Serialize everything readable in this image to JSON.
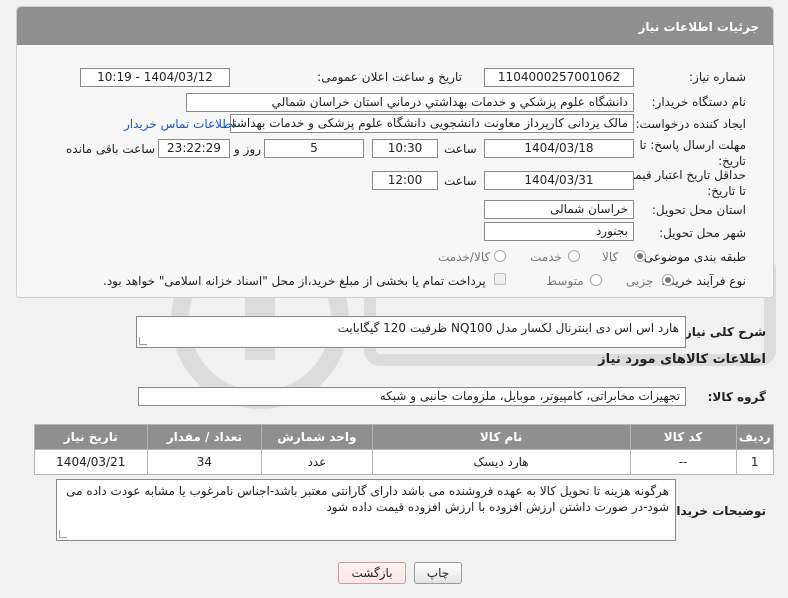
{
  "header": {
    "title": "جزئیات اطلاعات نیاز"
  },
  "labels": {
    "need_number": "شماره نیاز:",
    "announce_datetime": "تاریخ و ساعت اعلان عمومی:",
    "buyer_org": "نام دستگاه خریدار:",
    "requester": "ایجاد کننده درخواست:",
    "reply_deadline": "مهلت ارسال پاسخ: تا تاریخ:",
    "price_validity": "حداقل تاریخ اعتبار قیمت: تا تاریخ:",
    "time": "ساعت",
    "day_and": "روز و",
    "hours_left": "ساعت باقی مانده",
    "delivery_province": "استان محل تحویل:",
    "delivery_city": "شهر محل تحویل:",
    "category": "طبقه بندی موضوعی:",
    "purchase_process": "نوع فرآیند خرید :",
    "general_desc": "شرح کلی نیاز:",
    "items_info": "اطلاعات کالاهای مورد نیاز",
    "goods_group": "گروه کالا:",
    "buyer_notes": "توضیحات خریدار:"
  },
  "fields": {
    "need_number": "1104000257001062",
    "announce_datetime": "1404/03/12 - 10:19",
    "buyer_org": "دانشگاه علوم پزشکي و خدمات بهداشتي درماني استان خراسان شمالي",
    "requester": "مالک یزدانی کارپرداز معاونت دانشجویی دانشگاه علوم پزشکی و خدمات بهداشتی",
    "contact_link": "اطلاعات تماس خریدار",
    "reply_date": "1404/03/18",
    "reply_time": "10:30",
    "remaining_days": "5",
    "remaining_time": "23:22:29",
    "validity_date": "1404/03/31",
    "validity_time": "12:00",
    "delivery_province": "خراسان شمالی",
    "delivery_city": "بجنورد",
    "general_desc": "هارد اس اس دی اینترنال لکسار مدل NQ100 ظرفیت 120 گیگابایت",
    "goods_group": "تجهیزات مخابراتی، کامپیوتر، موبایل، ملزومات جانبی و شبکه",
    "buyer_notes": "هرگونه هزینه تا تحویل کالا به عهده فروشنده می باشد دارای گارانتی معتبر باشد-اجناس نامرغوب یا مشابه عودت داده می شود-در صورت داشتن ارزش افزوده با ارزش افزوده قیمت داده شود"
  },
  "category_options": [
    {
      "label": "کالا",
      "selected": true
    },
    {
      "label": "خدمت",
      "selected": false
    },
    {
      "label": "کالا/خدمت",
      "selected": false
    }
  ],
  "process_options": [
    {
      "label": "جزیی",
      "selected": true
    },
    {
      "label": "متوسط",
      "selected": false
    }
  ],
  "payment_note": "پرداخت تمام یا بخشی از مبلغ خرید،از محل \"اسناد خزانه اسلامی\" خواهد بود.",
  "table": {
    "headers": [
      "ردیف",
      "کد کالا",
      "نام کالا",
      "واحد شمارش",
      "تعداد / مقدار",
      "تاریخ نیاز"
    ],
    "rows": [
      [
        "1",
        "--",
        "هارد دیسک",
        "عدد",
        "34",
        "1404/03/21"
      ]
    ]
  },
  "buttons": {
    "print": "چاپ",
    "back": "بازگشت"
  },
  "colors": {
    "header_bg": "#8f8f8f",
    "link": "#1a56c5",
    "back_button_bg": "#fde6e6"
  }
}
